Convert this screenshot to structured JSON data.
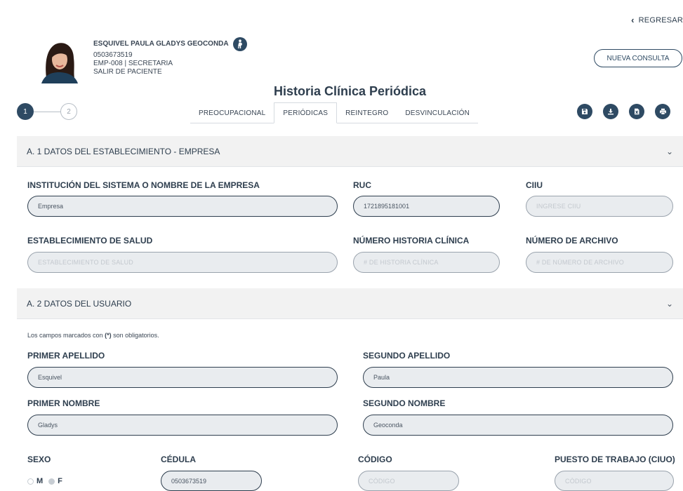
{
  "header": {
    "back_label": "REGRESAR",
    "new_consult_label": "NUEVA CONSULTA",
    "page_title": "Historia Clínica Periódica"
  },
  "patient": {
    "name": "ESQUIVEL PAULA GLADYS GEOCONDA",
    "id": "0503673519",
    "employee": "EMP-008 | SECRETARIA",
    "status": "SALIR DE PACIENTE"
  },
  "stepper": {
    "steps": [
      "1",
      "2"
    ],
    "active": 1
  },
  "tabs": [
    "PREOCUPACIONAL",
    "PERIÓDICAS",
    "REINTEGRO",
    "DESVINCULACIÓN"
  ],
  "active_tab": "PERIÓDICAS",
  "action_icons": [
    "save-icon",
    "download-icon",
    "excel-icon",
    "print-icon"
  ],
  "section_a1": {
    "title": "A. 1 DATOS DEL ESTABLECIMIENTO - EMPRESA",
    "institution_label": "INSTITUCIÓN DEL SISTEMA O NOMBRE DE LA EMPRESA",
    "institution_value": "Empresa",
    "ruc_label": "RUC",
    "ruc_value": "1721895181001",
    "ciiu_label": "CIIU",
    "ciiu_placeholder": "INGRESE CIIU",
    "establishment_label": "ESTABLECIMIENTO DE SALUD",
    "establishment_placeholder": "ESTABLECIMIENTO DE SALUD",
    "history_label": "NÚMERO HISTORIA CLÍNICA",
    "history_placeholder": "# DE HISTORIA CLÍNICA",
    "archive_label": "NÚMERO DE ARCHIVO",
    "archive_placeholder": "# DE NÚMERO DE ARCHIVO"
  },
  "section_a2": {
    "title": "A. 2 DATOS DEL USUARIO",
    "note_prefix": "Los campos marcados con",
    "note_marker": "(*)",
    "note_suffix": "son obligatorios.",
    "first_surname_label": "PRIMER APELLIDO",
    "first_surname_value": "Esquivel",
    "second_surname_label": "SEGUNDO APELLIDO",
    "second_surname_value": "Paula",
    "first_name_label": "PRIMER NOMBRE",
    "first_name_value": "Gladys",
    "second_name_label": "SEGUNDO NOMBRE",
    "second_name_value": "Geoconda",
    "sex_label": "SEXO",
    "sex_options": [
      "M",
      "F"
    ],
    "sex_selected": "F",
    "cedula_label": "CÉDULA",
    "cedula_value": "0503673519",
    "code_label": "CÓDIGO",
    "code_placeholder": "CÓDIGO",
    "job_label": "PUESTO DE TRABAJO (CIUO)",
    "job_placeholder": "CÓDIGO"
  },
  "colors": {
    "primary": "#2e4a63",
    "section_bg": "#f2f2f2",
    "input_bg": "#e9ecef"
  }
}
